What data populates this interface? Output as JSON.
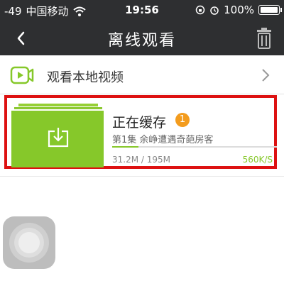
{
  "status_bar": {
    "signal": "-49",
    "carrier": "中国移动",
    "time": "19:56",
    "battery": "100%",
    "icons": [
      "wifi-icon",
      "rotation-lock-icon",
      "alarm-icon",
      "battery-icon"
    ]
  },
  "nav": {
    "title": "离线观看",
    "back_icon": "chevron-left-icon",
    "trash_icon": "trash-icon"
  },
  "local_videos": {
    "label": "观看本地视频",
    "icon": "video-play-icon"
  },
  "download_item": {
    "title": "正在缓存",
    "count": "1",
    "episode": "第1集 余峥遭遇奇葩房客",
    "size": "31.2M / 195M",
    "speed": "560K/S",
    "progress": 0.16,
    "thumb_icon": "download-icon"
  },
  "colors": {
    "bar_bg": "#2e2f31",
    "accent_green": "#86c82a",
    "badge_orange": "#f39c1e",
    "highlight_red": "#dd1111"
  }
}
